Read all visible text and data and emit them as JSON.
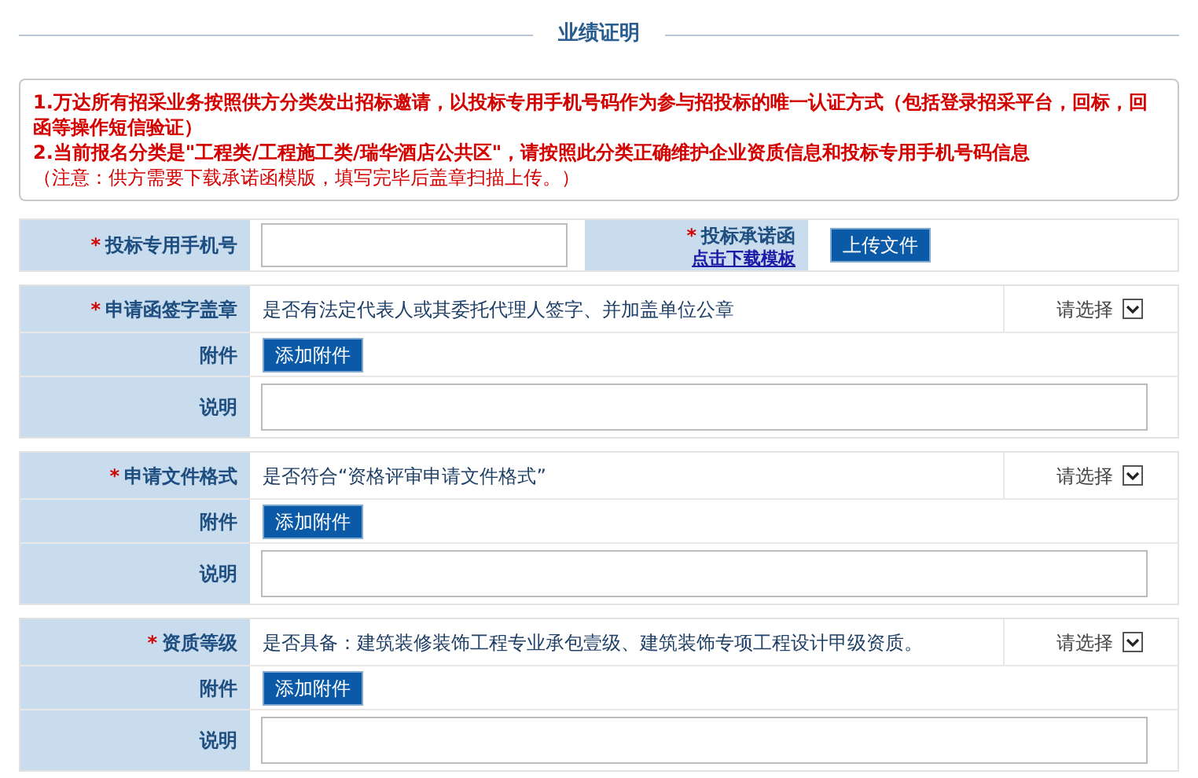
{
  "title": "业绩证明",
  "notices": [
    {
      "kind": "item",
      "text": "1.万达所有招采业务按照供方分类发出招标邀请，以投标专用手机号码作为参与招投标的唯一认证方式（包括登录招采平台，回标，回函等操作短信验证）"
    },
    {
      "kind": "item",
      "text": "2.当前报名分类是\"工程类/工程施工类/瑞华酒店公共区\"，请按照此分类正确维护企业资质信息和投标专用手机号码信息"
    },
    {
      "kind": "note",
      "text": "（注意：供方需要下载承诺函模版，填写完毕后盖章扫描上传。）"
    }
  ],
  "contact": {
    "phone_label": "投标专用手机号",
    "phone_required": "*",
    "letter_label": "投标承诺函",
    "letter_required": "*",
    "template_link": "点击下载模板",
    "upload_button": "上传文件"
  },
  "sections": [
    {
      "label": "申请函签字盖章",
      "required": "*",
      "question": "是否有法定代表人或其委托代理人签字、并加盖单位公章",
      "select": "请选择",
      "attachment_label": "附件",
      "attachment_button": "添加附件",
      "note_label": "说明"
    },
    {
      "label": "申请文件格式",
      "required": "*",
      "question": "是否符合“资格评审申请文件格式”",
      "select": "请选择",
      "attachment_label": "附件",
      "attachment_button": "添加附件",
      "note_label": "说明"
    },
    {
      "label": "资质等级",
      "required": "*",
      "question": "是否具备：建筑装修装饰工程专业承包壹级、建筑装饰专项工程设计甲级资质。",
      "select": "请选择",
      "attachment_label": "附件",
      "attachment_button": "添加附件",
      "note_label": "说明"
    }
  ]
}
